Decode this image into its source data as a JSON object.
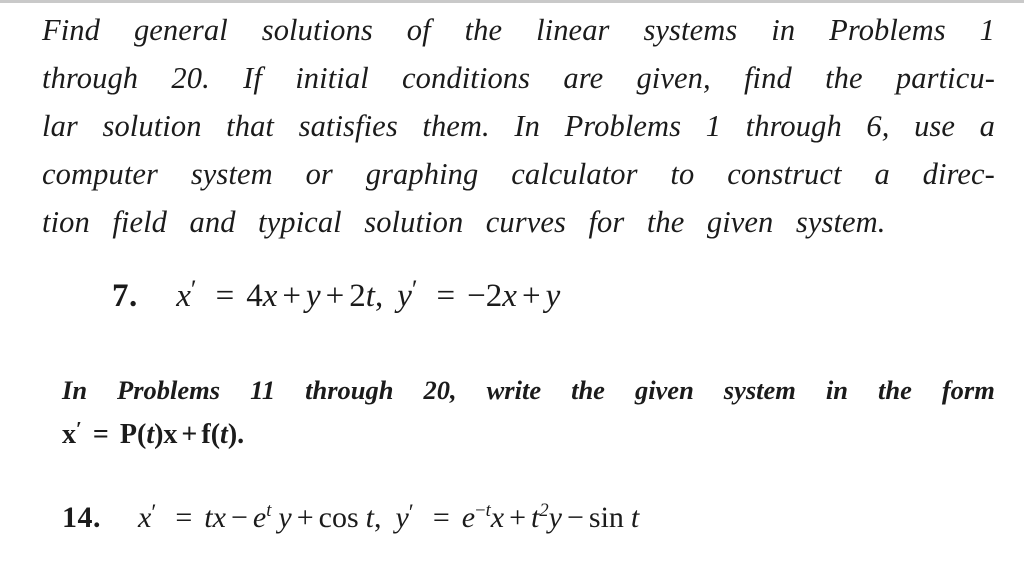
{
  "page": {
    "background_color": "#ffffff",
    "text_color": "#1b1b1b",
    "rule_color": "#c9c9c9"
  },
  "intro": {
    "full_text": "Find general solutions of the linear systems in Problems 1 through 20. If initial conditions are given, find the particular solution that satisfies them. In Problems 1 through 6, use a computer system or graphing calculator to construct a direction field and typical solution curves for the given system.",
    "lines": [
      {
        "words": [
          "Find",
          "general",
          "solutions",
          "of",
          "the",
          "linear",
          "systems",
          "in",
          "Problems",
          "1"
        ]
      },
      {
        "words": [
          "through",
          "20.",
          "If",
          "initial",
          "conditions",
          "are",
          "given,",
          "find",
          "the",
          "particu-"
        ]
      },
      {
        "words": [
          "lar",
          "solution",
          "that",
          "satisfies",
          "them.",
          "In",
          "Problems",
          "1",
          "through",
          "6,",
          "use",
          "a"
        ]
      },
      {
        "words": [
          "computer",
          "system",
          "or",
          "graphing",
          "calculator",
          "to",
          "construct",
          "a",
          "direc-"
        ]
      },
      {
        "words": [
          "tion",
          "field",
          "and",
          "typical",
          "solution",
          "curves",
          "for",
          "the",
          "given",
          "system."
        ]
      }
    ]
  },
  "problem_7": {
    "number_label": "7.",
    "equation_text": "x′ = 4x + y + 2t, y′ = −2x + y",
    "equation_1": {
      "lhs_var": "x",
      "prime": "′",
      "equals": "=",
      "terms": "4x + y + 2t",
      "trailing_comma": ","
    },
    "equation_2": {
      "lhs_var": "y",
      "prime": "′",
      "equals": "=",
      "terms": "−2x + y"
    },
    "tokens": {
      "four": "4",
      "x": "x",
      "plus": "+",
      "y": "y",
      "two": "2",
      "t": "t",
      "minus": "−",
      "comma": ","
    }
  },
  "instruction_block": {
    "line1_text": "In Problems 11 through 20, write the given system in the form",
    "line1_words": [
      "In",
      "Problems",
      "11",
      "through",
      "20,",
      "write",
      "the",
      "given",
      "system",
      "in",
      "the",
      "form"
    ],
    "formula_text": "x′ = P(t)x + f(t).",
    "formula_tokens": {
      "x_bold": "x",
      "prime": "′",
      "equals": "=",
      "P": "P",
      "open_paren": "(",
      "t": "t",
      "close_paren": ")",
      "x2": "x",
      "plus": "+",
      "f": "f",
      "open_paren2": "(",
      "t2": "t",
      "close_paren2": ")",
      "period": "."
    }
  },
  "problem_14": {
    "number_label": "14.",
    "equation_text": "x′ = tx − e^t y + cos t,  y′ = e^−t x + t² y − sin t",
    "tokens": {
      "x": "x",
      "prime": "′",
      "equals": "=",
      "t": "t",
      "minus": "−",
      "e": "e",
      "exp_t": "t",
      "y": "y",
      "plus": "+",
      "cos": "cos",
      "comma": ",",
      "exp_minus": "−",
      "exp_two": "2",
      "sin": "sin"
    }
  }
}
